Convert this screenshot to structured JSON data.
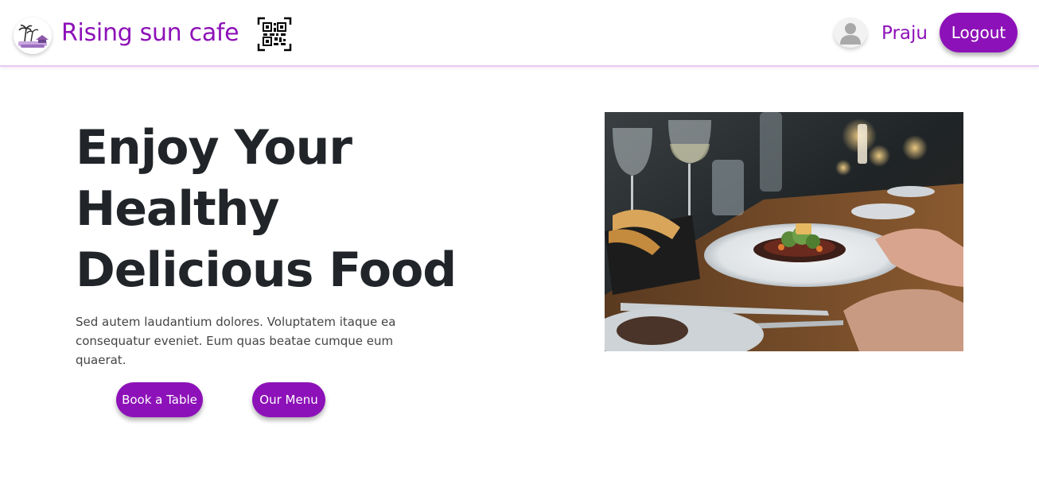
{
  "header": {
    "brand": "Rising sun cafe",
    "logo_icon": "palm-beach-logo-icon",
    "qr_icon": "qr-code-icon",
    "avatar_icon": "user-avatar-icon",
    "username": "Praju",
    "logout_label": "Logout"
  },
  "hero": {
    "title_lines": [
      "Enjoy Your",
      "Healthy",
      "Delicious Food"
    ],
    "description": "Sed autem laudantium dolores. Voluptatem itaque ea consequatur eveniet. Eum quas beatae cumque eum quaerat.",
    "book_label": "Book a Table",
    "menu_label": "Our Menu",
    "image_icon": "restaurant-dish-photo"
  },
  "colors": {
    "brand": "#8d11b8",
    "text": "#212529",
    "muted": "#444444",
    "header_border": "#e7c9f0"
  }
}
